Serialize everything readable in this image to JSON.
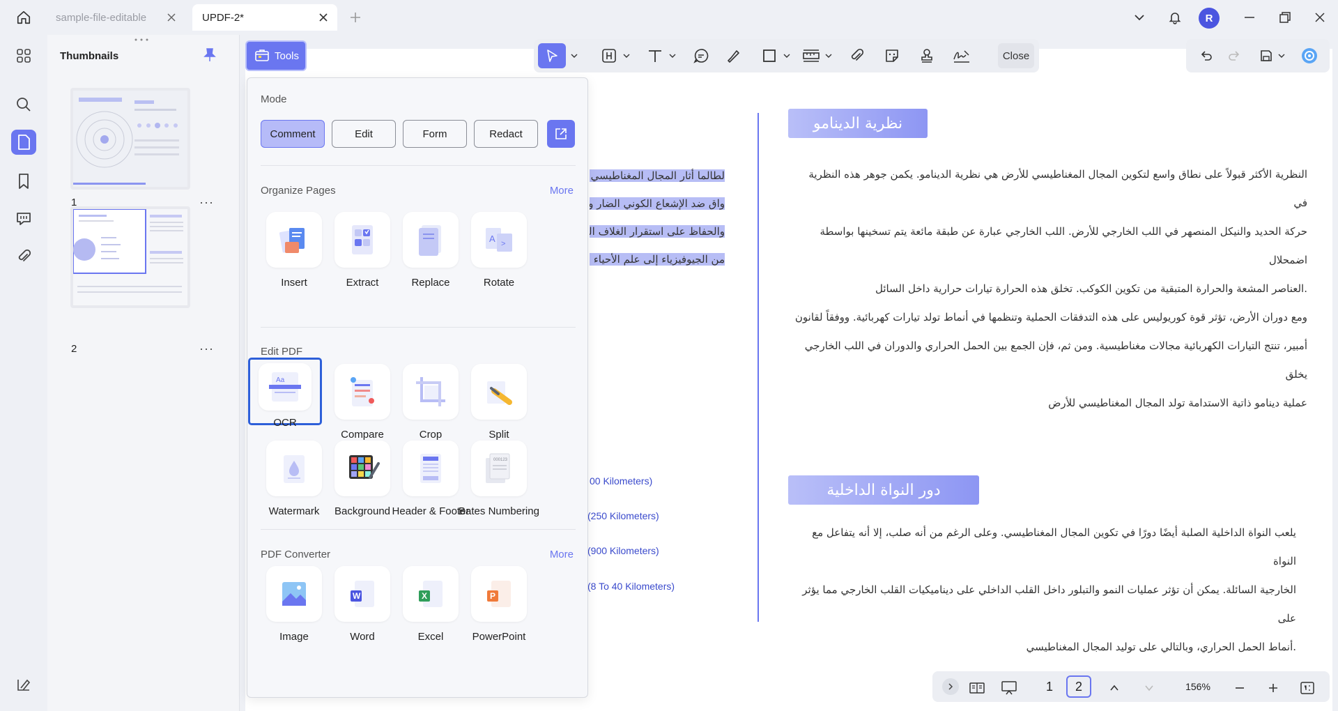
{
  "tabs": [
    {
      "label": "sample-file-editable",
      "active": false
    },
    {
      "label": "UPDF-2*",
      "active": true
    }
  ],
  "user": {
    "avatar_letter": "R"
  },
  "thumbnails": {
    "title": "Thumbnails",
    "pages": [
      {
        "num": "1",
        "more": "···"
      },
      {
        "num": "2",
        "more": "···"
      }
    ]
  },
  "toolbar": {
    "tools_label": "Tools",
    "close_label": "Close"
  },
  "tools_panel": {
    "mode_title": "Mode",
    "modes": [
      "Comment",
      "Edit",
      "Form",
      "Redact"
    ],
    "organize_title": "Organize Pages",
    "organize_more": "More",
    "organize": [
      "Insert",
      "Extract",
      "Replace",
      "Rotate"
    ],
    "edit_title": "Edit PDF",
    "edit": [
      "OCR",
      "Compare",
      "Crop",
      "Split",
      "Watermark",
      "Background",
      "Header & Footer",
      "Bates Numbering"
    ],
    "converter_title": "PDF Converter",
    "converter_more": "More",
    "converter": [
      "Image",
      "Word",
      "Excel",
      "PowerPoint"
    ]
  },
  "document": {
    "heading1": "نظرية الدينامو",
    "heading2": "دور النواة الداخلية",
    "para1": [
      "النظرية الأكثر قبولاً على نطاق واسع لتكوين المجال المغناطيسي للأرض هي نظرية الدينامو. يكمن جوهر هذه النظرية في",
      "حركة الحديد والنيكل المنصهر في اللب الخارجي للأرض. اللب الخارجي عبارة عن طبقة مائعة يتم تسخينها بواسطة اضمحلال",
      ".العناصر المشعة والحرارة المتبقية من تكوين الكوكب. تخلق هذه الحرارة تيارات حرارية داخل السائل",
      "ومع دوران الأرض، تؤثر قوة كوريوليس على هذه التدفقات الحملية وتنظمها في أنماط تولد تيارات كهربائية. ووفقاً لقانون",
      "أمبير، تنتج التيارات الكهربائية مجالات مغناطيسية. ومن ثم، فإن الجمع بين الحمل الحراري والدوران في اللب الخارجي يخلق",
      "عملية دينامو ذاتية الاستدامة تولد المجال المغناطيسي للأرض"
    ],
    "para2": [
      "يلعب النواة الداخلية الصلبة أيضًا دورًا في تكوين المجال المغناطيسي. وعلى الرغم من أنه صلب، إلا أنه يتفاعل مع النواة",
      "الخارجية السائلة. يمكن أن تؤثر عمليات النمو والتبلور داخل القلب الداخلي على ديناميكيات القلب الخارجي مما يؤثر على",
      ".أنماط الحمل الحراري، وبالتالي على توليد المجال المغناطيسي"
    ],
    "left_lines": [
      "لطالما أثار المجال المغناطيسي للأ",
      "واق ضد الإشعاع الكوني الضار و",
      "والحفاظ على استقرار الغلاف الج",
      "من الجيوفيزياء إلى علم الأحياء ال"
    ],
    "km_lines": [
      "00 Kilometers)",
      "(250 Kilometers)",
      "(900 Kilometers)",
      "(8 To 40 Kilometers)"
    ]
  },
  "bottom": {
    "page1": "1",
    "page2": "2",
    "zoom": "156%"
  },
  "colors": {
    "accent": "#6a76f0",
    "selected_border": "#2d5fd9"
  }
}
